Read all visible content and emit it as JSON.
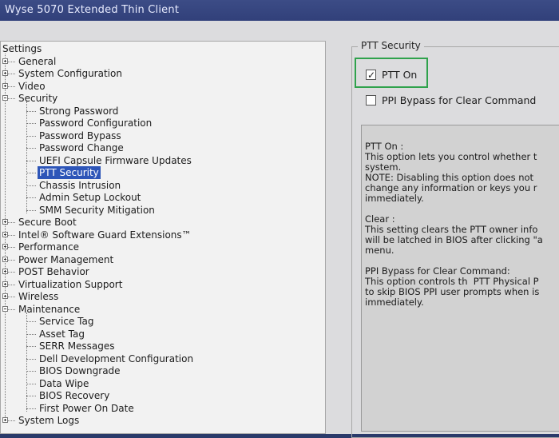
{
  "window": {
    "title": "Wyse 5070 Extended Thin Client"
  },
  "tree": {
    "root_label": "Settings",
    "items": [
      {
        "label": "General",
        "level": 1,
        "expander": "plus"
      },
      {
        "label": "System Configuration",
        "level": 1,
        "expander": "plus"
      },
      {
        "label": "Video",
        "level": 1,
        "expander": "plus"
      },
      {
        "label": "Security",
        "level": 1,
        "expander": "minus"
      },
      {
        "label": "Strong Password",
        "level": 2
      },
      {
        "label": "Password Configuration",
        "level": 2
      },
      {
        "label": "Password Bypass",
        "level": 2
      },
      {
        "label": "Password Change",
        "level": 2
      },
      {
        "label": "UEFI Capsule Firmware Updates",
        "level": 2
      },
      {
        "label": "PTT Security",
        "level": 2,
        "selected": true
      },
      {
        "label": "Chassis Intrusion",
        "level": 2
      },
      {
        "label": "Admin Setup Lockout",
        "level": 2
      },
      {
        "label": "SMM Security Mitigation",
        "level": 2
      },
      {
        "label": "Secure Boot",
        "level": 1,
        "expander": "plus"
      },
      {
        "label": "Intel® Software Guard Extensions™",
        "level": 1,
        "expander": "plus"
      },
      {
        "label": "Performance",
        "level": 1,
        "expander": "plus"
      },
      {
        "label": "Power Management",
        "level": 1,
        "expander": "plus"
      },
      {
        "label": "POST Behavior",
        "level": 1,
        "expander": "plus"
      },
      {
        "label": "Virtualization Support",
        "level": 1,
        "expander": "plus"
      },
      {
        "label": "Wireless",
        "level": 1,
        "expander": "plus"
      },
      {
        "label": "Maintenance",
        "level": 1,
        "expander": "minus"
      },
      {
        "label": "Service Tag",
        "level": 2
      },
      {
        "label": "Asset Tag",
        "level": 2
      },
      {
        "label": "SERR Messages",
        "level": 2
      },
      {
        "label": "Dell Development Configuration",
        "level": 2
      },
      {
        "label": "BIOS Downgrade",
        "level": 2
      },
      {
        "label": "Data Wipe",
        "level": 2
      },
      {
        "label": "BIOS Recovery",
        "level": 2
      },
      {
        "label": "First Power On Date",
        "level": 2
      },
      {
        "label": "System Logs",
        "level": 1,
        "expander": "plus"
      }
    ]
  },
  "panel": {
    "group_title": "PTT Security",
    "options": [
      {
        "label": "PTT On",
        "checked": true
      },
      {
        "label": "PPI Bypass for Clear Command",
        "checked": false
      }
    ],
    "help_lines": [
      "PTT On :",
      "This option lets you control whether t",
      "system.",
      "NOTE: Disabling this option does not",
      "change any information or keys you r",
      "immediately.",
      "",
      "Clear :",
      "This setting clears the PTT owner info",
      "will be latched in BIOS after clicking \"a",
      "menu.",
      "",
      "PPI Bypass for Clear Command:",
      "This option controls th  PTT Physical P",
      "to skip BIOS PPI user prompts when is",
      "immediately."
    ]
  },
  "colors": {
    "titlebar": "#31407a",
    "selection": "#2d55b8",
    "focus_border": "#2fa24c"
  },
  "icons": {
    "cursor": "mouse-pointer-icon"
  }
}
